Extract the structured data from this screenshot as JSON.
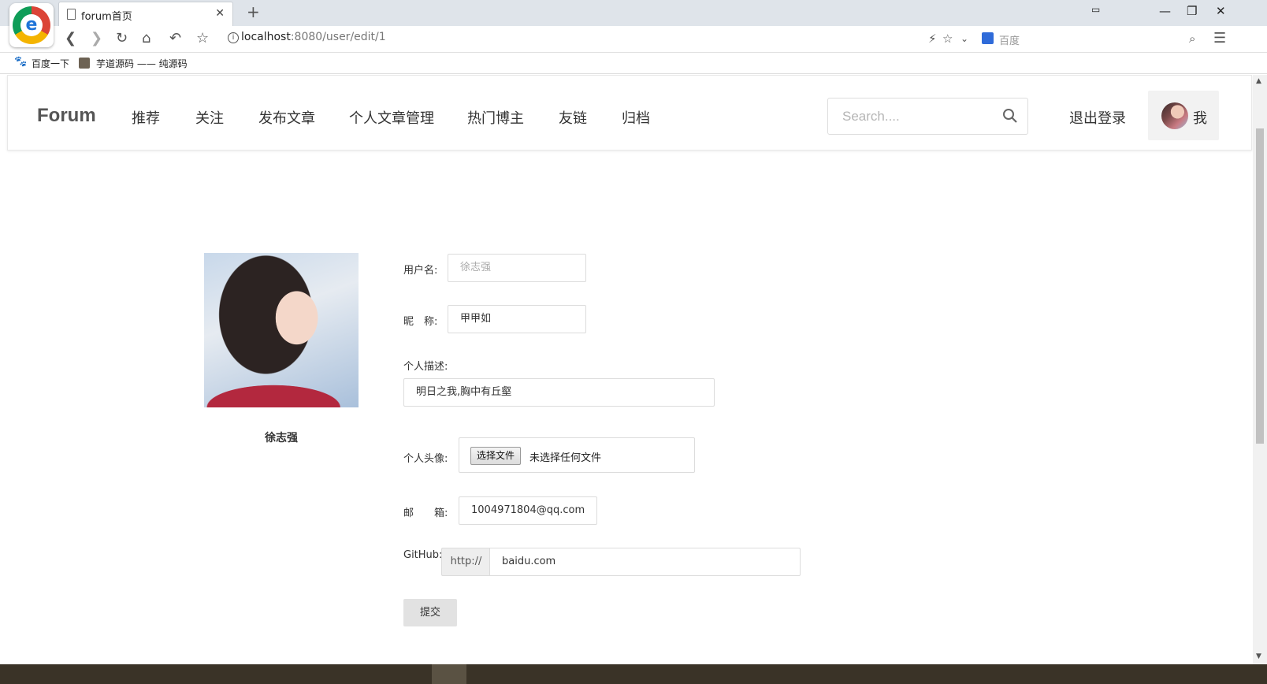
{
  "browser": {
    "tab_title": "forum首页",
    "url_host": "localhost",
    "url_rest": ":8080/user/edit/1",
    "search_placeholder": "百度",
    "bookmarks": [
      "百度一下",
      "芋道源码 —— 纯源码"
    ]
  },
  "navbar": {
    "brand": "Forum",
    "items": [
      "推荐",
      "关注",
      "发布文章",
      "个人文章管理",
      "热门博主",
      "友链",
      "归档"
    ],
    "search_placeholder": "Search....",
    "logout": "退出登录",
    "me": "我"
  },
  "profile": {
    "name": "徐志强"
  },
  "form": {
    "username_label": "用户名:",
    "username_value": "徐志强",
    "nickname_label": "昵　称:",
    "nickname_value": "甲甲如",
    "description_label": "个人描述:",
    "description_value": "明日之我,胸中有丘壑",
    "avatar_label": "个人头像:",
    "file_button": "选择文件",
    "file_status": "未选择任何文件",
    "email_label": "邮　　箱:",
    "email_value": "1004971804@qq.com",
    "github_label": "GitHub:",
    "github_prefix": "http://",
    "github_value": "baidu.com",
    "submit": "提交"
  }
}
